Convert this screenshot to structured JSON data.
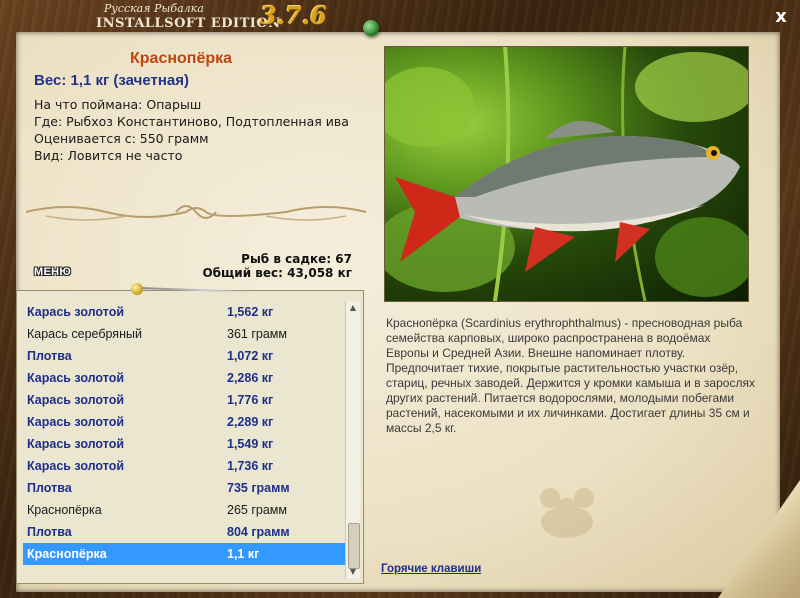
{
  "app": {
    "title_small": "Русская Рыбалка",
    "title_big": "INSTALLSOFT EDITION",
    "version": "3.7.6",
    "close_label": "x"
  },
  "fish": {
    "name": "Краснопёрка",
    "weight_line": "Вес: 1,1 кг (зачетная)",
    "caught_on": "На что поймана: Опарыш",
    "place": "Где: Рыбхоз Константиново, Подтопленная ива",
    "rated_from": "Оценивается с: 550 грамм",
    "kind": "Вид: Ловится не часто"
  },
  "cage": {
    "count": "Рыб в садке: 67",
    "total": "Общий вес: 43,058 кг"
  },
  "menu_label": "МЕНЮ",
  "catch_list": [
    {
      "name": "Карась золотой",
      "weight": "1,562 кг",
      "bold": true
    },
    {
      "name": "Карась серебряный",
      "weight": "361 грамм",
      "bold": false
    },
    {
      "name": "Плотва",
      "weight": "1,072 кг",
      "bold": true
    },
    {
      "name": "Карась золотой",
      "weight": "2,286 кг",
      "bold": true
    },
    {
      "name": "Карась золотой",
      "weight": "1,776 кг",
      "bold": true
    },
    {
      "name": "Карась золотой",
      "weight": "2,289 кг",
      "bold": true
    },
    {
      "name": "Карась золотой",
      "weight": "1,549 кг",
      "bold": true
    },
    {
      "name": "Карась золотой",
      "weight": "1,736 кг",
      "bold": true
    },
    {
      "name": "Плотва",
      "weight": "735 грамм",
      "bold": true
    },
    {
      "name": "Краснопёрка",
      "weight": "265 грамм",
      "bold": false
    },
    {
      "name": "Плотва",
      "weight": "804 грамм",
      "bold": true
    },
    {
      "name": "Краснопёрка",
      "weight": "1,1 кг",
      "bold": true,
      "selected": true
    }
  ],
  "description": "Краснопёрка (Scardinius erythrophthalmus) - пресноводная рыба семейства карповых, широко распространена в водоёмах Европы и Средней Азии. Внешне напоминает плотву. Предпочитает тихие, покрытые растительностью участки озёр, стариц, речных заводей. Держится у кромки камыша и в зарослях других растений. Питается водорослями, молодыми побегами растений, насекомыми и их личинками. Достигает длины 35 см и массы 2,5 кг.",
  "hotkeys_label": "Горячие клавиши",
  "colors": {
    "fish_name": "#c1440e",
    "bold_row": "#1e2e8a",
    "selection": "#3399ff"
  }
}
